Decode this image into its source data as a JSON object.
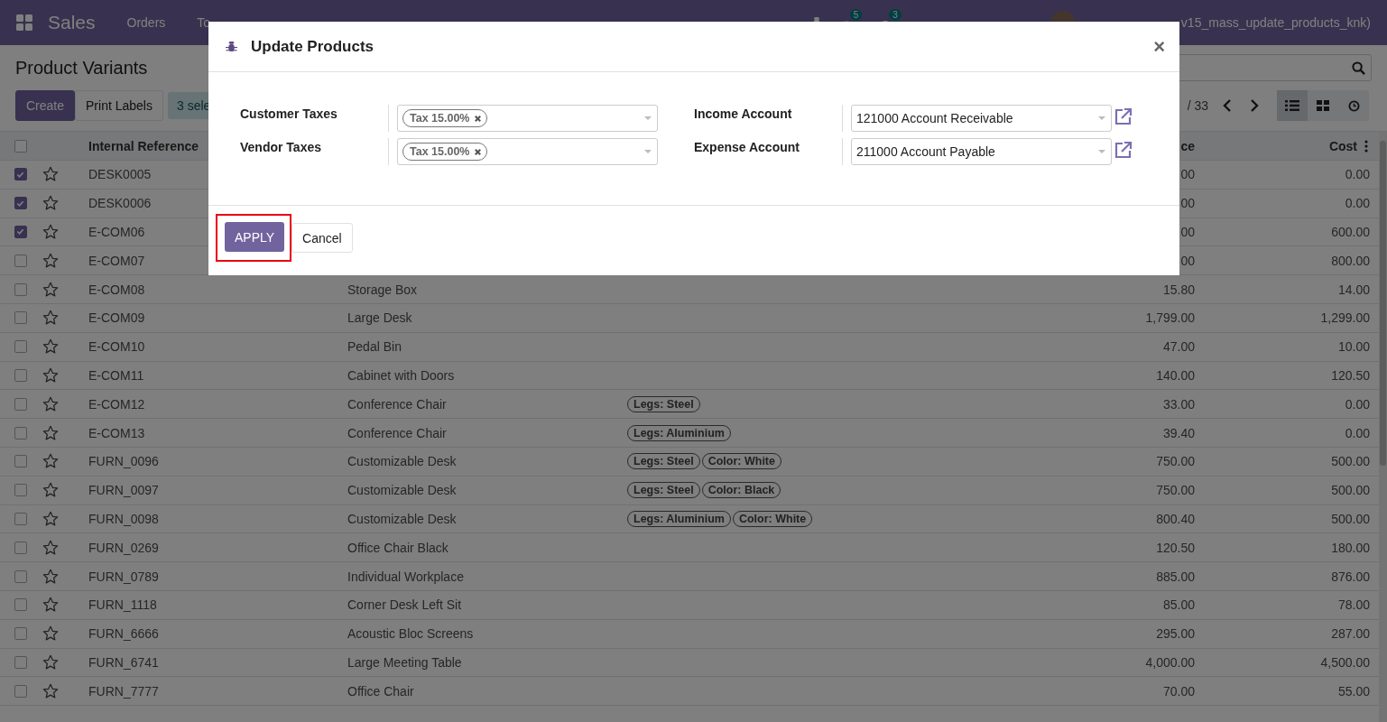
{
  "navbar": {
    "app": "Sales",
    "menu": [
      "Orders",
      "To"
    ],
    "chat_badge": "5",
    "activity_badge": "3",
    "user": "v15_mass_update_products_knk)"
  },
  "control_panel": {
    "title": "Product Variants",
    "buttons": [
      "Create",
      "Print Labels"
    ],
    "selection": "3 sele",
    "pager": "/ 33",
    "views": [
      {
        "kind": "list",
        "selected": true
      },
      {
        "kind": "kanban",
        "selected": false
      },
      {
        "kind": "activity",
        "selected": false
      }
    ]
  },
  "table": {
    "all_selected": false,
    "columns": [
      "Internal Reference",
      "ce",
      "Cost"
    ],
    "rows": [
      {
        "selected": true,
        "reference": "DESK0005",
        "price": "00",
        "cost": "0.00"
      },
      {
        "selected": true,
        "reference": "DESK0006",
        "price": "00",
        "cost": "0.00"
      },
      {
        "selected": true,
        "reference": "E-COM06",
        "price": "00",
        "cost": "600.00"
      },
      {
        "selected": false,
        "reference": "E-COM07",
        "price": "00",
        "cost": "800.00"
      },
      {
        "selected": false,
        "reference": "E-COM08",
        "name": "Storage Box",
        "price": "15.80",
        "cost": "14.00"
      },
      {
        "selected": false,
        "reference": "E-COM09",
        "name": "Large Desk",
        "price": "1,799.00",
        "cost": "1,299.00"
      },
      {
        "selected": false,
        "reference": "E-COM10",
        "name": "Pedal Bin",
        "price": "47.00",
        "cost": "10.00"
      },
      {
        "selected": false,
        "reference": "E-COM11",
        "name": "Cabinet with Doors",
        "price": "140.00",
        "cost": "120.50"
      },
      {
        "selected": false,
        "reference": "E-COM12",
        "name": "Conference Chair",
        "attributes": [
          "Legs: Steel"
        ],
        "price": "33.00",
        "cost": "0.00"
      },
      {
        "selected": false,
        "reference": "E-COM13",
        "name": "Conference Chair",
        "attributes": [
          "Legs: Aluminium"
        ],
        "price": "39.40",
        "cost": "0.00"
      },
      {
        "selected": false,
        "reference": "FURN_0096",
        "name": "Customizable Desk",
        "attributes": [
          "Legs: Steel",
          "Color: White"
        ],
        "price": "750.00",
        "cost": "500.00"
      },
      {
        "selected": false,
        "reference": "FURN_0097",
        "name": "Customizable Desk",
        "attributes": [
          "Legs: Steel",
          "Color: Black"
        ],
        "price": "750.00",
        "cost": "500.00"
      },
      {
        "selected": false,
        "reference": "FURN_0098",
        "name": "Customizable Desk",
        "attributes": [
          "Legs: Aluminium",
          "Color: White"
        ],
        "price": "800.40",
        "cost": "500.00"
      },
      {
        "selected": false,
        "reference": "FURN_0269",
        "name": "Office Chair Black",
        "price": "120.50",
        "cost": "180.00"
      },
      {
        "selected": false,
        "reference": "FURN_0789",
        "name": "Individual Workplace",
        "price": "885.00",
        "cost": "876.00"
      },
      {
        "selected": false,
        "reference": "FURN_1118",
        "name": "Corner Desk Left Sit",
        "price": "85.00",
        "cost": "78.00"
      },
      {
        "selected": false,
        "reference": "FURN_6666",
        "name": "Acoustic Bloc Screens",
        "price": "295.00",
        "cost": "287.00"
      },
      {
        "selected": false,
        "reference": "FURN_6741",
        "name": "Large Meeting Table",
        "price": "4,000.00",
        "cost": "4,500.00"
      },
      {
        "selected": false,
        "reference": "FURN_7777",
        "name": "Office Chair",
        "price": "70.00",
        "cost": "55.00"
      }
    ]
  },
  "dialog": {
    "title": "Update Products",
    "close": "×",
    "left_fields": [
      {
        "label": "Customer Taxes",
        "tags": [
          "Tax 15.00%"
        ]
      },
      {
        "label": "Vendor Taxes",
        "tags": [
          "Tax 15.00%"
        ]
      }
    ],
    "right_fields": [
      {
        "label": "Income Account",
        "value": "121000 Account Receivable"
      },
      {
        "label": "Expense Account",
        "value": "211000 Account Payable"
      }
    ],
    "apply": {
      "label": "APPLY",
      "highlighted": true
    },
    "cancel": "Cancel"
  }
}
